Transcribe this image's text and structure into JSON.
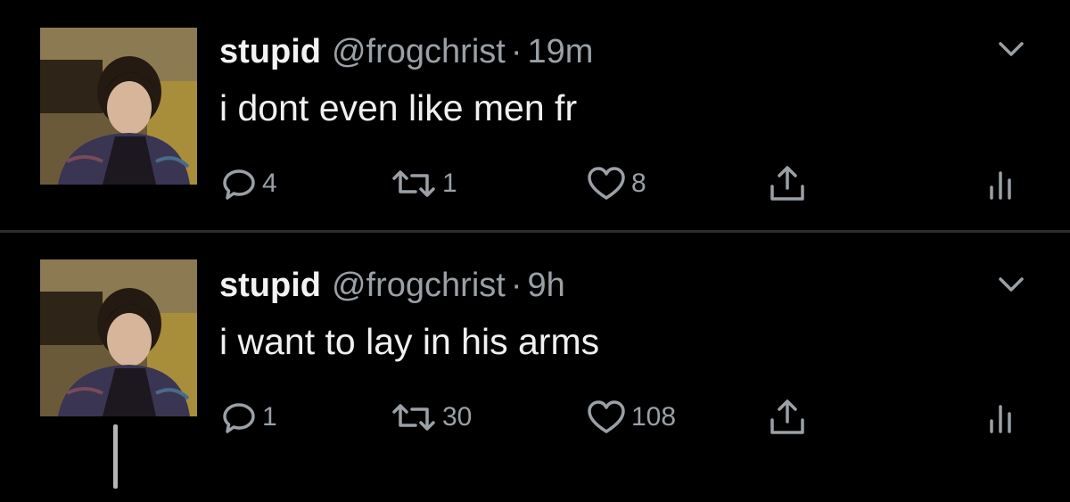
{
  "tweets": [
    {
      "display_name": "stupid",
      "handle": "@frogchrist",
      "separator": "·",
      "time": "19m",
      "text": "i dont even like men fr",
      "replies": "4",
      "retweets": "1",
      "likes": "8"
    },
    {
      "display_name": "stupid",
      "handle": "@frogchrist",
      "separator": "·",
      "time": "9h",
      "text": "i want to lay in his arms",
      "replies": "1",
      "retweets": "30",
      "likes": "108"
    }
  ],
  "icons": {
    "reply": "reply-icon",
    "retweet": "retweet-icon",
    "like": "heart-icon",
    "share": "share-icon",
    "stats": "analytics-icon",
    "menu": "chevron-down-icon"
  },
  "colors": {
    "background": "#000000",
    "text": "#e7e9ea",
    "muted": "#9aa0a6",
    "divider": "#2a2d30"
  }
}
